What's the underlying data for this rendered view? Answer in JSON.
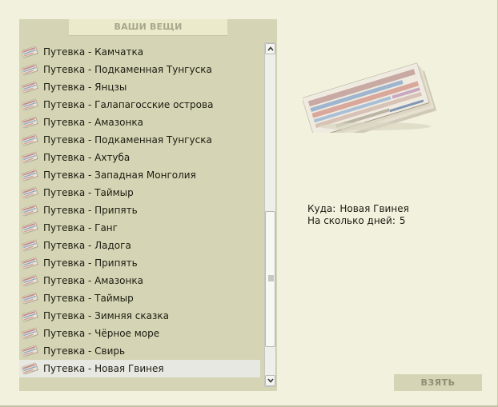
{
  "panel": {
    "title": "ВАШИ ВЕЩИ",
    "items": [
      {
        "label": "Путевка - Камчатка"
      },
      {
        "label": "Путевка - Подкаменная Тунгуска"
      },
      {
        "label": "Путевка - Янцзы"
      },
      {
        "label": "Путевка - Галапагосские острова"
      },
      {
        "label": "Путевка - Амазонка"
      },
      {
        "label": "Путевка - Подкаменная Тунгуска"
      },
      {
        "label": "Путевка - Ахтуба"
      },
      {
        "label": "Путевка - Западная Монголия"
      },
      {
        "label": "Путевка - Таймыр"
      },
      {
        "label": "Путевка - Припять"
      },
      {
        "label": "Путевка - Ганг"
      },
      {
        "label": "Путевка - Ладога"
      },
      {
        "label": "Путевка - Припять"
      },
      {
        "label": "Путевка - Амазонка"
      },
      {
        "label": "Путевка - Таймыр"
      },
      {
        "label": "Путевка - Зимняя сказка"
      },
      {
        "label": "Путевка - Чёрное море"
      },
      {
        "label": "Путевка - Свирь"
      },
      {
        "label": "Путевка - Новая Гвинея",
        "selected": true
      }
    ],
    "item_icon": "ticket-icon"
  },
  "details": {
    "destination_label": "Куда:",
    "destination_value": "Новая Гвинея",
    "days_label": "На сколько дней:",
    "days_value": "5"
  },
  "actions": {
    "take_label": "ВЗЯТЬ"
  },
  "scrollbar": {
    "position": 0.85
  },
  "colors": {
    "background": "#f2f1de",
    "panel": "#d5d4b4",
    "header_tab": "#ebeacb",
    "header_text": "#a8a78e",
    "selected_row": "#e8e8e2",
    "text": "#1c1c12"
  }
}
